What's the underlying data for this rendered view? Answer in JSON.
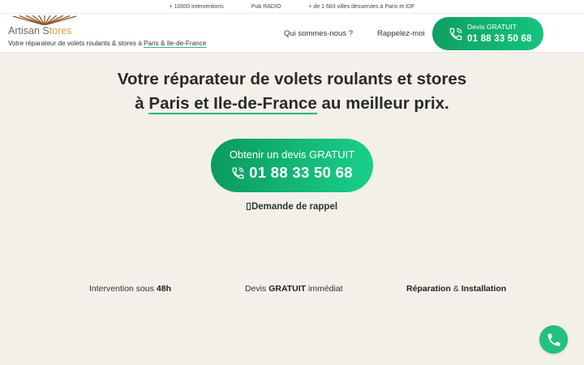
{
  "topbar": {
    "interventions": "+ 10000 interventions",
    "radio": "Pub RADIO",
    "cities": "+ de 1 683 villes desservies à Paris et IDF"
  },
  "brand": {
    "logo_main": "Artisan S",
    "logo_accent": "tores",
    "tagline_prefix": "Votre réparateur de volets roulants & stores à ",
    "tagline_highlight": "Paris & Ile-de-France"
  },
  "nav": {
    "who": "Qui sommes-nous ?",
    "callback": "Rappelez-moi"
  },
  "header_cta": {
    "label": "Devis GRATUIT",
    "phone": "01 88 33 50 68"
  },
  "hero": {
    "line1": "Votre réparateur de volets roulants et stores",
    "line2_prefix": "à ",
    "line2_highlight": "Paris et Ile-de-France",
    "line2_suffix": " au meilleur prix."
  },
  "main_cta": {
    "label": "Obtenir un devis GRATUIT",
    "phone": "01 88 33 50 68"
  },
  "callback": {
    "label": "Demande de rappel"
  },
  "features": {
    "f1_prefix": "Intervention sous ",
    "f1_bold": "48h",
    "f2_prefix": "Devis ",
    "f2_bold": "GRATUIT",
    "f2_suffix": " immédiat",
    "f3_bold1": "Réparation",
    "f3_mid": " & ",
    "f3_bold2": "Installation"
  },
  "colors": {
    "accent_green": "#16c47f",
    "logo_gold": "#d9a03b",
    "background": "#f2f0e9"
  },
  "icons": [
    "phone-icon",
    "sunrise-logo-icon",
    "checkbox-icon"
  ]
}
